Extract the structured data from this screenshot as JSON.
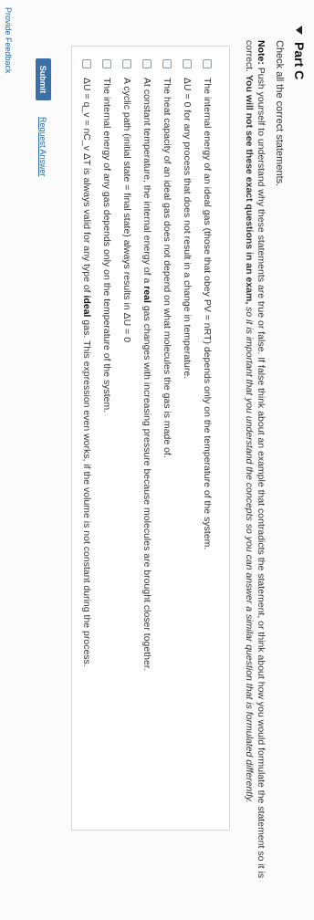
{
  "part": {
    "title": "Part C"
  },
  "instruction": "Check all the correct statements.",
  "note": {
    "lead": "Note:",
    "body": "Push yourself to understand why these statements are true or false. If false think about an example that contradicts the statement, or think about how you would formulate the statement so it is correct.",
    "bold_tail": "You will not see these exact questions in an exam,",
    "italic_tail": "so it is important that you understand the concepts so you can answer a similar question that is formulated differently."
  },
  "choices": [
    {
      "text": "The internal energy of an ideal gas (those that obey PV = nRT) depends only on the temperature of the system."
    },
    {
      "text": "ΔU = 0 for any process that does not result in a change in temperature."
    },
    {
      "text": "The heat capacity of an ideal gas does not depend on what molecules the gas is made of."
    },
    {
      "pre": "At constant temperature, the internal energy of a",
      "bold": "real",
      "post": "gas changes with increasing pressure because molecules are brought closer together."
    },
    {
      "text": "A cyclic path (initial state = final state) always results in ΔU = 0"
    },
    {
      "text": "The internal energy of any gas depends only on the temperature of the system."
    },
    {
      "pre": "ΔU = q_v = nC_v ΔT is always valid for any type of",
      "bold": "ideal",
      "post": "gas. This expression even works, if the volume is not constant during the process."
    }
  ],
  "actions": {
    "submit_label": "Submit",
    "request_answer_label": "Request Answer"
  },
  "footer": {
    "feedback_label": "Provide Feedback"
  }
}
